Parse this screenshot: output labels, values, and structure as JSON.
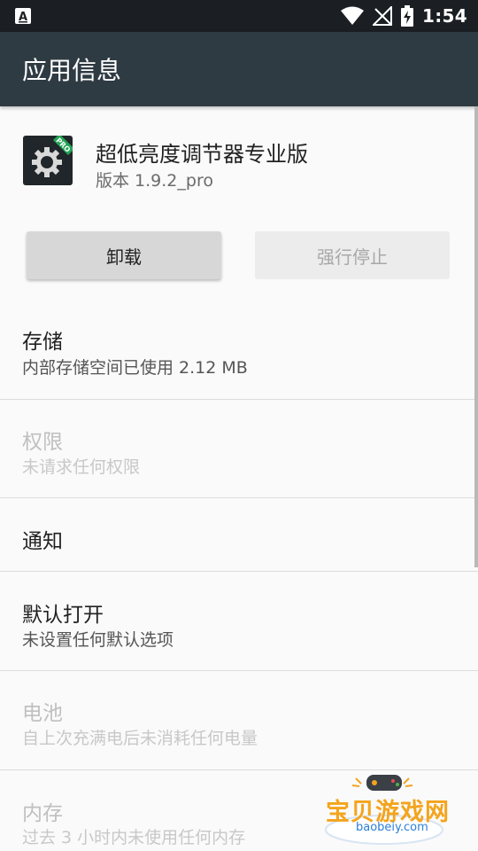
{
  "status_bar": {
    "time": "1:54",
    "notification_icon": "keyboard-a-icon",
    "wifi_icon": "wifi-icon",
    "signal_icon": "no-signal-icon",
    "battery_icon": "battery-charging-icon"
  },
  "app_bar": {
    "title": "应用信息"
  },
  "app": {
    "name": "超低亮度调节器专业版",
    "version": "版本 1.9.2_pro",
    "icon": "gear-icon",
    "badge": "PRO"
  },
  "buttons": {
    "uninstall": "卸载",
    "force_stop": "强行停止"
  },
  "sections": [
    {
      "title": "存储",
      "subtitle": "内部存储空间已使用 2.12 MB",
      "enabled": true
    },
    {
      "title": "权限",
      "subtitle": "未请求任何权限",
      "enabled": false
    },
    {
      "title": "通知",
      "subtitle": "",
      "enabled": true
    },
    {
      "title": "默认打开",
      "subtitle": "未设置任何默认选项",
      "enabled": true
    },
    {
      "title": "电池",
      "subtitle": "自上次充满电后未消耗任何电量",
      "enabled": false
    },
    {
      "title": "内存",
      "subtitle": "过去 3 小时内未使用任何内存",
      "enabled": false
    }
  ],
  "watermark": {
    "text": "宝贝游戏网",
    "url": "baobeiy.com"
  },
  "colors": {
    "status_bar": "#1b1f23",
    "app_bar": "#2f3b43",
    "background": "#fafafa",
    "watermark_orange": "#f4a41c",
    "watermark_blue": "#2a7fd8"
  }
}
